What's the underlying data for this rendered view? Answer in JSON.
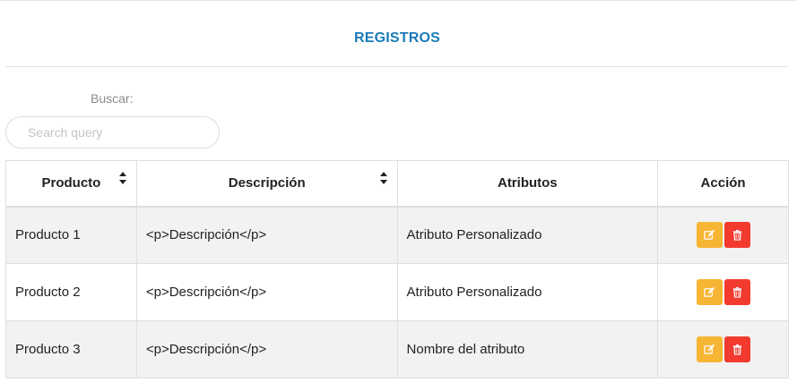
{
  "header": {
    "title": "REGISTROS"
  },
  "search": {
    "label": "Buscar:",
    "placeholder": "Search query"
  },
  "table": {
    "columns": [
      "Producto",
      "Descripción",
      "Atributos",
      "Acción"
    ],
    "sortable": [
      true,
      true,
      false,
      false
    ],
    "rows": [
      {
        "producto": "Producto 1",
        "descripcion": "<p>Descripción</p>",
        "atributos": "Atributo Personalizado"
      },
      {
        "producto": "Producto 2",
        "descripcion": "<p>Descripción</p>",
        "atributos": "Atributo Personalizado"
      },
      {
        "producto": "Producto 3",
        "descripcion": "<p>Descripción</p>",
        "atributos": "Nombre del atributo"
      }
    ]
  },
  "actions": {
    "edit_icon": "edit-icon",
    "delete_icon": "trash-icon"
  },
  "colors": {
    "title": "#1a7bb8",
    "edit": "#f7b534",
    "delete": "#f23a2f",
    "row_alt": "#f2f2f2"
  }
}
